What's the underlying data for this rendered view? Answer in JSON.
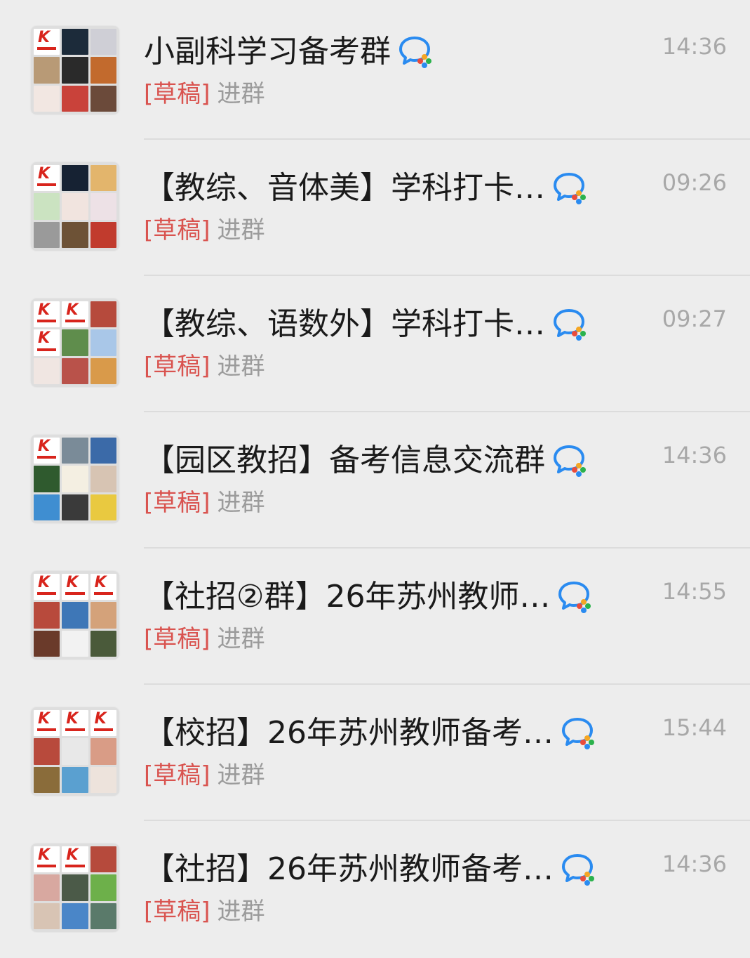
{
  "colors": {
    "background": "#ededed",
    "draft_tag": "#d9534f",
    "preview_text": "#9b9b9b",
    "time_text": "#a8a8a8",
    "group_icon_blue": "#2a8bf0"
  },
  "chats": [
    {
      "title": "小副科学习备考群",
      "draft_label": "[草稿]",
      "draft_text": "进群",
      "time": "14:36",
      "badge_icon": "work-group-chat-icon",
      "avatar_tiles": [
        "logo",
        "#1c2b3a",
        "#cfcfd6",
        "#b89a76",
        "#2a2a2a",
        "#c26a2d",
        "#f2e7e2",
        "#c9423a",
        "#6b4a3a"
      ]
    },
    {
      "title": "【教综、音体美】学科打卡…",
      "draft_label": "[草稿]",
      "draft_text": "进群",
      "time": "09:26",
      "badge_icon": "work-group-chat-icon",
      "avatar_tiles": [
        "logo",
        "#162233",
        "#e3b56c",
        "#cbe3c1",
        "#f1e4df",
        "#ede1e6",
        "#9a9a9a",
        "#6d5236",
        "#c13b2d"
      ]
    },
    {
      "title": "【教综、语数外】学科打卡…",
      "draft_label": "[草稿]",
      "draft_text": "进群",
      "time": "09:27",
      "badge_icon": "work-group-chat-icon",
      "avatar_tiles": [
        "logo",
        "logo",
        "#b64a3c",
        "logo",
        "#5f8d4c",
        "#a9c7e8",
        "#f0e6e2",
        "#b9524a",
        "#d99a4a"
      ]
    },
    {
      "title": "【园区教招】备考信息交流群",
      "draft_label": "[草稿]",
      "draft_text": "进群",
      "time": "14:36",
      "badge_icon": "work-group-chat-icon",
      "avatar_tiles": [
        "logo",
        "#7a8b98",
        "#3b6aa8",
        "#2f5a2e",
        "#f4efe2",
        "#d7c4b3",
        "#3f8ed1",
        "#3a3a3a",
        "#e9c940"
      ]
    },
    {
      "title": "【社招②群】26年苏州教师…",
      "draft_label": "[草稿]",
      "draft_text": "进群",
      "time": "14:55",
      "badge_icon": "work-group-chat-icon",
      "avatar_tiles": [
        "logo",
        "logo",
        "logo",
        "#b84a3c",
        "#3e77b7",
        "#d4a27a",
        "#6a3a2a",
        "#f2f2f2",
        "#4a5a3a"
      ]
    },
    {
      "title": "【校招】26年苏州教师备考…",
      "draft_label": "[草稿]",
      "draft_text": "进群",
      "time": "15:44",
      "badge_icon": "work-group-chat-icon",
      "avatar_tiles": [
        "logo",
        "logo",
        "logo",
        "#b84a3c",
        "#e8e8e8",
        "#d99c86",
        "#8a6c3a",
        "#5aa0d0",
        "#ede3dc"
      ]
    },
    {
      "title": "【社招】26年苏州教师备考…",
      "draft_label": "[草稿]",
      "draft_text": "进群",
      "time": "14:36",
      "badge_icon": "work-group-chat-icon",
      "avatar_tiles": [
        "logo",
        "logo",
        "#b64a3c",
        "#d8a8a0",
        "#4b5a48",
        "#6db04a",
        "#d8c4b4",
        "#4a86c8",
        "#5a7a6a"
      ]
    }
  ]
}
